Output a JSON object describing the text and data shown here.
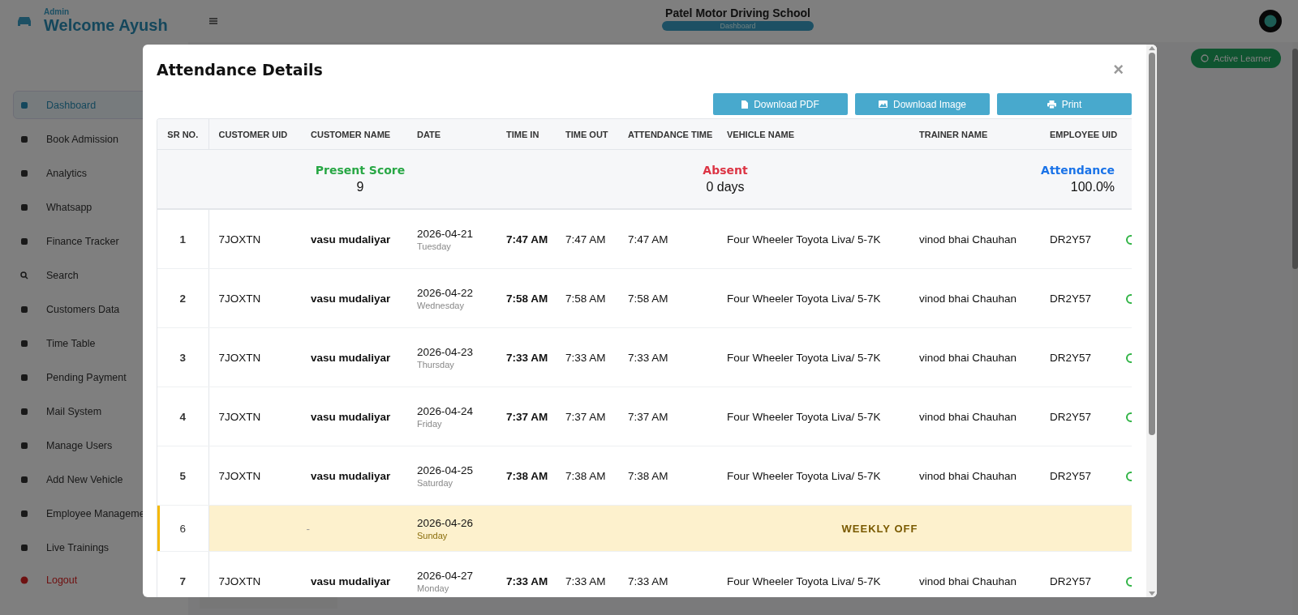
{
  "header": {
    "role": "Admin",
    "welcome": "Welcome Ayush",
    "school": "Patel Motor Driving School",
    "page_badge": "Dashboard"
  },
  "sidebar": {
    "items": [
      {
        "label": "Dashboard",
        "selected": true
      },
      {
        "label": "Book Admission",
        "selected": false
      },
      {
        "label": "Analytics",
        "selected": false
      },
      {
        "label": "Whatsapp",
        "selected": false
      },
      {
        "label": "Finance Tracker",
        "selected": false
      },
      {
        "label": "Search",
        "selected": false
      },
      {
        "label": "Customers Data",
        "selected": false
      },
      {
        "label": "Time Table",
        "selected": false
      },
      {
        "label": "Pending Payment",
        "selected": false
      },
      {
        "label": "Mail System",
        "selected": false
      },
      {
        "label": "Manage Users",
        "selected": false
      },
      {
        "label": "Add New Vehicle",
        "selected": false
      },
      {
        "label": "Employee Manageme",
        "selected": false
      },
      {
        "label": "Live Trainings",
        "selected": false
      }
    ],
    "logout": "Logout"
  },
  "main": {
    "action_button": "Active Learner"
  },
  "modal": {
    "title": "Attendance Details",
    "close": "×",
    "buttons": [
      {
        "label": "Download PDF",
        "kind": "pdf"
      },
      {
        "label": "Download Image",
        "kind": "image"
      },
      {
        "label": "Print",
        "kind": "print"
      }
    ],
    "table": {
      "columns": [
        "SR NO.",
        "CUSTOMER UID",
        "CUSTOMER NAME",
        "DATE",
        "TIME IN",
        "TIME OUT",
        "ATTENDANCE TIME",
        "VEHICLE NAME",
        "TRAINER NAME",
        "EMPLOYEE UID"
      ],
      "summary": [
        {
          "label": "Present Score",
          "value": "9",
          "color": "#28a745"
        },
        {
          "label": "Absent",
          "value": "0 days",
          "color": "#dc3545"
        },
        {
          "label": "Attendance",
          "value": "100.0%",
          "color": "#1a73e8"
        }
      ],
      "rows": [
        {
          "kind": "attendance",
          "sr": "1",
          "customer_uid": "7JOXTN",
          "customer_name": "vasu mudaliyar",
          "date": "2026-04-21",
          "day": "Tuesday",
          "time_in": "7:47 AM",
          "time_out": "7:47 AM",
          "attendance_time": "7:47 AM",
          "vehicle": "Four Wheeler Toyota Liva/ 5-7K",
          "trainer": "vinod bhai Chauhan",
          "employee_uid": "DR2Y57"
        },
        {
          "kind": "attendance",
          "sr": "2",
          "customer_uid": "7JOXTN",
          "customer_name": "vasu mudaliyar",
          "date": "2026-04-22",
          "day": "Wednesday",
          "time_in": "7:58 AM",
          "time_out": "7:58 AM",
          "attendance_time": "7:58 AM",
          "vehicle": "Four Wheeler Toyota Liva/ 5-7K",
          "trainer": "vinod bhai Chauhan",
          "employee_uid": "DR2Y57"
        },
        {
          "kind": "attendance",
          "sr": "3",
          "customer_uid": "7JOXTN",
          "customer_name": "vasu mudaliyar",
          "date": "2026-04-23",
          "day": "Thursday",
          "time_in": "7:33 AM",
          "time_out": "7:33 AM",
          "attendance_time": "7:33 AM",
          "vehicle": "Four Wheeler Toyota Liva/ 5-7K",
          "trainer": "vinod bhai Chauhan",
          "employee_uid": "DR2Y57"
        },
        {
          "kind": "attendance",
          "sr": "4",
          "customer_uid": "7JOXTN",
          "customer_name": "vasu mudaliyar",
          "date": "2026-04-24",
          "day": "Friday",
          "time_in": "7:37 AM",
          "time_out": "7:37 AM",
          "attendance_time": "7:37 AM",
          "vehicle": "Four Wheeler Toyota Liva/ 5-7K",
          "trainer": "vinod bhai Chauhan",
          "employee_uid": "DR2Y57"
        },
        {
          "kind": "attendance",
          "sr": "5",
          "customer_uid": "7JOXTN",
          "customer_name": "vasu mudaliyar",
          "date": "2026-04-25",
          "day": "Saturday",
          "time_in": "7:38 AM",
          "time_out": "7:38 AM",
          "attendance_time": "7:38 AM",
          "vehicle": "Four Wheeler Toyota Liva/ 5-7K",
          "trainer": "vinod bhai Chauhan",
          "employee_uid": "DR2Y57"
        },
        {
          "kind": "weekly_off",
          "sr": "6",
          "customer": "-",
          "date": "2026-04-26",
          "day": "Sunday",
          "status": "WEEKLY OFF"
        },
        {
          "kind": "attendance",
          "sr": "7",
          "customer_uid": "7JOXTN",
          "customer_name": "vasu mudaliyar",
          "date": "2026-04-27",
          "day": "Monday",
          "time_in": "7:33 AM",
          "time_out": "7:33 AM",
          "attendance_time": "7:33 AM",
          "vehicle": "Four Wheeler Toyota Liva/ 5-7K",
          "trainer": "vinod bhai Chauhan",
          "employee_uid": "DR2Y57"
        }
      ]
    }
  }
}
